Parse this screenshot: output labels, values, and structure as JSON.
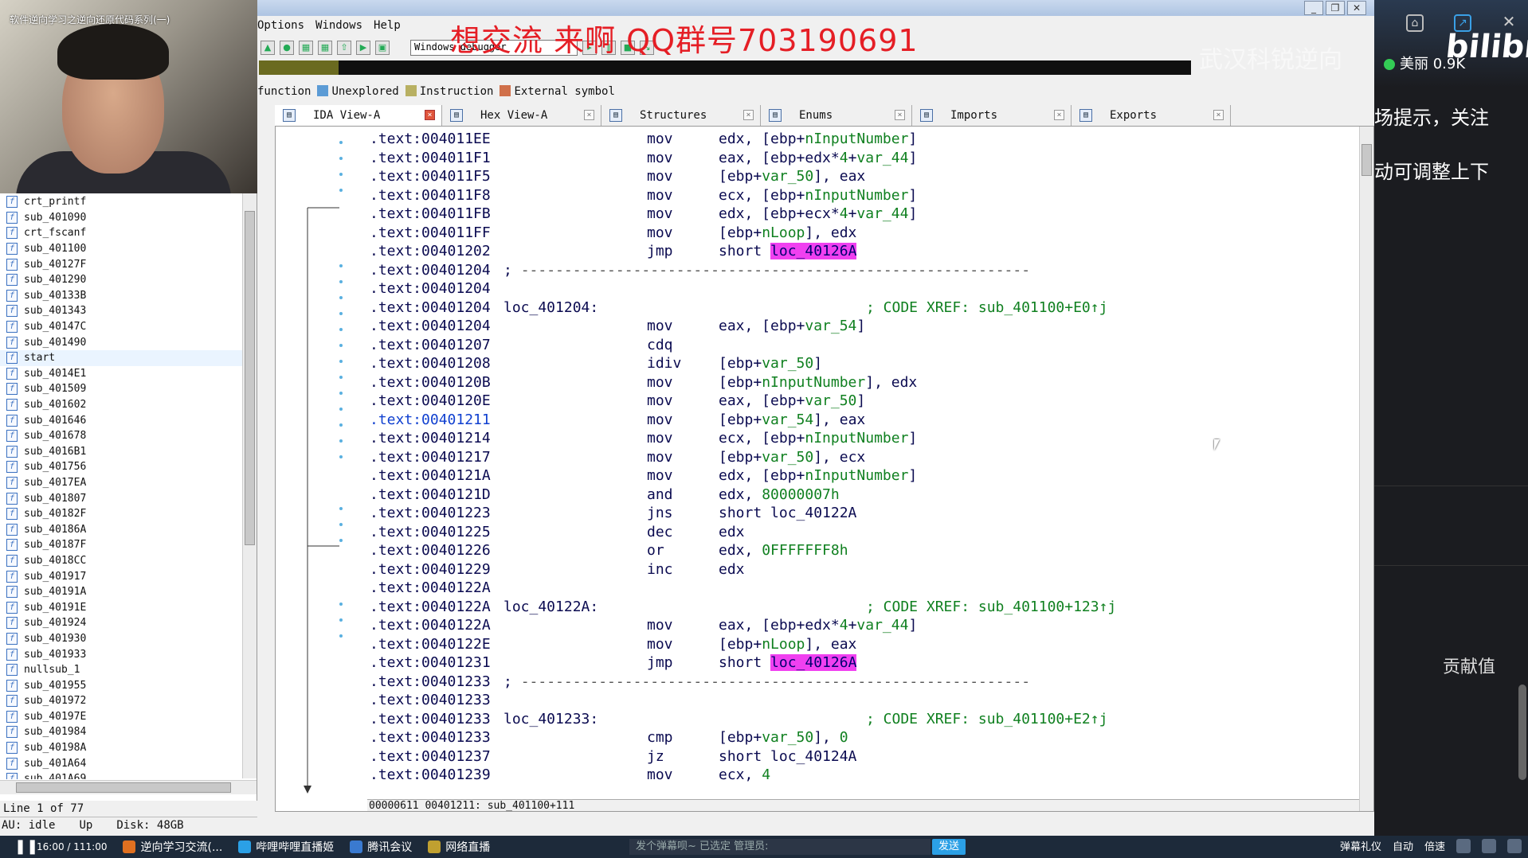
{
  "webcam": {
    "title": "软件逆向学习之逆向还原代码系列(一)"
  },
  "overlay": {
    "promo": "想交流 来啊 QQ群号703190691",
    "watermark": "武汉科锐逆向"
  },
  "menu": [
    "Options",
    "Windows",
    "Help"
  ],
  "toolbar": {
    "debugger": "Windows debugger"
  },
  "legend": [
    {
      "label": "function",
      "color": "#5b9bd5"
    },
    {
      "label": "Unexplored",
      "color": "#b8b062"
    },
    {
      "label": "Instruction",
      "color": "#d0704a"
    },
    {
      "label": "External symbol",
      "color": "#f090f0"
    }
  ],
  "functions": {
    "items": [
      "crt_printf",
      "sub_401090",
      "crt_fscanf",
      "sub_401100",
      "sub_40127F",
      "sub_401290",
      "sub_40133B",
      "sub_401343",
      "sub_40147C",
      "sub_401490",
      "start",
      "sub_4014E1",
      "sub_401509",
      "sub_401602",
      "sub_401646",
      "sub_401678",
      "sub_4016B1",
      "sub_401756",
      "sub_4017EA",
      "sub_401807",
      "sub_40182F",
      "sub_40186A",
      "sub_40187F",
      "sub_4018CC",
      "sub_401917",
      "sub_40191A",
      "sub_40191E",
      "sub_401924",
      "sub_401930",
      "sub_401933",
      "nullsub_1",
      "sub_401955",
      "sub_401972",
      "sub_40197E",
      "sub_401984",
      "sub_40198A",
      "sub_401A64",
      "sub_401A69"
    ],
    "selected": "start",
    "line_info": "Line 1 of 77"
  },
  "status": {
    "au": "AU:",
    "state": "idle",
    "dir": "Up",
    "disk": "Disk: 48GB"
  },
  "tabs": [
    {
      "label": "IDA View-A",
      "active": true
    },
    {
      "label": "Hex View-A",
      "active": false
    },
    {
      "label": "Structures",
      "active": false
    },
    {
      "label": "Enums",
      "active": false
    },
    {
      "label": "Imports",
      "active": false
    },
    {
      "label": "Exports",
      "active": false
    }
  ],
  "disasm": {
    "status": "00000611 00401211: sub_401100+111",
    "lines": [
      {
        "addr": ".text:004011EE",
        "mnem": "mov",
        "ops": "edx, [ebp+nInputNumber]"
      },
      {
        "addr": ".text:004011F1",
        "mnem": "mov",
        "ops": "eax, [ebp+edx*4+var_44]"
      },
      {
        "addr": ".text:004011F5",
        "mnem": "mov",
        "ops": "[ebp+var_50], eax"
      },
      {
        "addr": ".text:004011F8",
        "mnem": "mov",
        "ops": "ecx, [ebp+nInputNumber]"
      },
      {
        "addr": ".text:004011FB",
        "mnem": "mov",
        "ops": "edx, [ebp+ecx*4+var_44]"
      },
      {
        "addr": ".text:004011FF",
        "mnem": "mov",
        "ops": "[ebp+nLoop], edx"
      },
      {
        "addr": ".text:00401202",
        "mnem": "jmp",
        "ops": "short ",
        "hl": "loc_40126A"
      },
      {
        "addr": ".text:00401204",
        "sep": true
      },
      {
        "addr": ".text:00401204"
      },
      {
        "addr": ".text:00401204",
        "label": "loc_401204:",
        "cmt": "; CODE XREF: sub_401100+E0↑j"
      },
      {
        "addr": ".text:00401204",
        "mnem": "mov",
        "ops": "eax, [ebp+var_54]"
      },
      {
        "addr": ".text:00401207",
        "mnem": "cdq",
        "ops": ""
      },
      {
        "addr": ".text:00401208",
        "mnem": "idiv",
        "ops": "[ebp+var_50]"
      },
      {
        "addr": ".text:0040120B",
        "mnem": "mov",
        "ops": "[ebp+nInputNumber], edx"
      },
      {
        "addr": ".text:0040120E",
        "mnem": "mov",
        "ops": "eax, [ebp+var_50]"
      },
      {
        "addr": ".text:00401211",
        "mnem": "mov",
        "ops": "[ebp+var_54], eax",
        "cur": true
      },
      {
        "addr": ".text:00401214",
        "mnem": "mov",
        "ops": "ecx, [ebp+nInputNumber]"
      },
      {
        "addr": ".text:00401217",
        "mnem": "mov",
        "ops": "[ebp+var_50], ecx"
      },
      {
        "addr": ".text:0040121A",
        "mnem": "mov",
        "ops": "edx, [ebp+nInputNumber]"
      },
      {
        "addr": ".text:0040121D",
        "mnem": "and",
        "ops": "edx, 80000007h"
      },
      {
        "addr": ".text:00401223",
        "mnem": "jns",
        "ops": "short loc_40122A"
      },
      {
        "addr": ".text:00401225",
        "mnem": "dec",
        "ops": "edx"
      },
      {
        "addr": ".text:00401226",
        "mnem": "or",
        "ops": "edx, 0FFFFFFF8h"
      },
      {
        "addr": ".text:00401229",
        "mnem": "inc",
        "ops": "edx"
      },
      {
        "addr": ".text:0040122A"
      },
      {
        "addr": ".text:0040122A",
        "label": "loc_40122A:",
        "cmt": "; CODE XREF: sub_401100+123↑j"
      },
      {
        "addr": ".text:0040122A",
        "mnem": "mov",
        "ops": "eax, [ebp+edx*4+var_44]"
      },
      {
        "addr": ".text:0040122E",
        "mnem": "mov",
        "ops": "[ebp+nLoop], eax"
      },
      {
        "addr": ".text:00401231",
        "mnem": "jmp",
        "ops": "short ",
        "hl": "loc_40126A"
      },
      {
        "addr": ".text:00401233",
        "sep": true
      },
      {
        "addr": ".text:00401233"
      },
      {
        "addr": ".text:00401233",
        "label": "loc_401233:",
        "cmt": "; CODE XREF: sub_401100+E2↑j"
      },
      {
        "addr": ".text:00401233",
        "mnem": "cmp",
        "ops": "[ebp+var_50], 0"
      },
      {
        "addr": ".text:00401237",
        "mnem": "jz",
        "ops": "short loc_40124A"
      },
      {
        "addr": ".text:00401239",
        "mnem": "mov",
        "ops": "ecx, 4"
      }
    ]
  },
  "side": {
    "logo": "bilibili",
    "online": "美丽 0.9K",
    "tip1": "场提示，关注",
    "tip2": "动可调整上下",
    "contrib": "贡献值"
  },
  "taskbar": {
    "time": "16:00 / 111:00",
    "tasks": [
      "逆向学习交流(...",
      "哔哩哔哩直播姬",
      "腾讯会议",
      "网络直播"
    ],
    "danmaku_placeholder": "发个弹幕呗~ 已选定 管理员:",
    "send": "发送",
    "tray": [
      "弹幕礼仪",
      "自动",
      "倍速"
    ]
  }
}
